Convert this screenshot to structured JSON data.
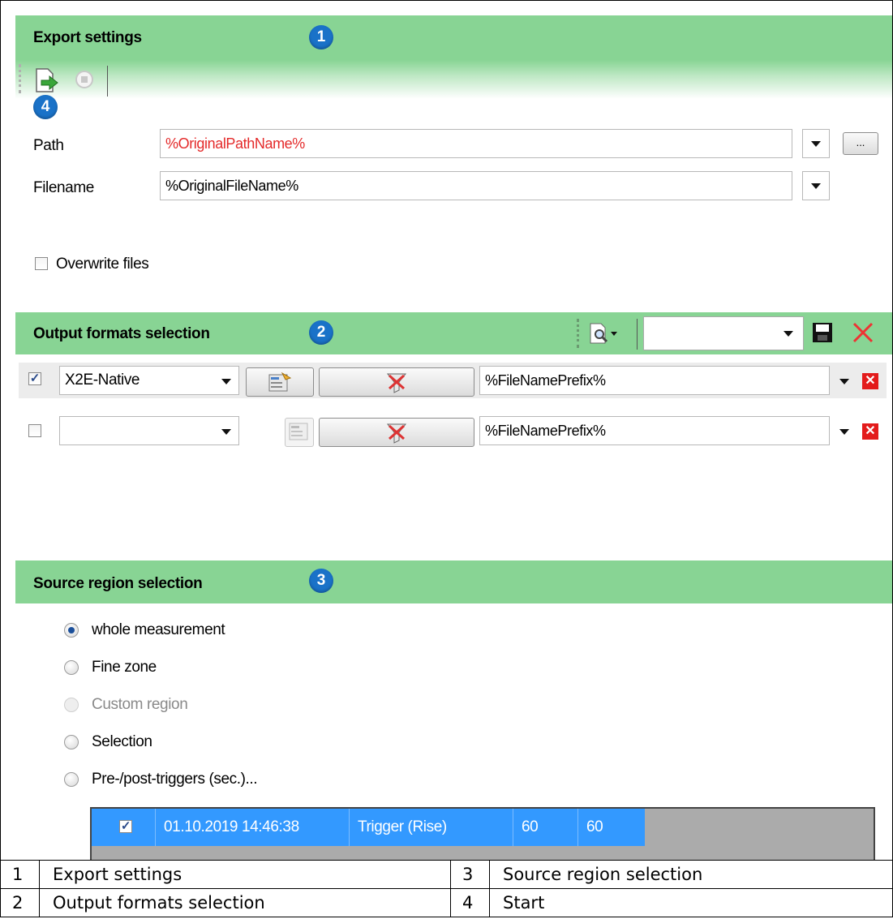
{
  "export_settings": {
    "title": "Export settings",
    "badge": "1",
    "start_badge": "4",
    "path_label": "Path",
    "path_value": "%OriginalPathName%",
    "browse_label": "...",
    "filename_label": "Filename",
    "filename_value": "%OriginalFileName%",
    "overwrite_label": "Overwrite files"
  },
  "output_formats": {
    "title": "Output formats selection",
    "badge": "2",
    "rows": [
      {
        "format": "X2E-Native",
        "prefix": "%FileNamePrefix%",
        "checked": true
      },
      {
        "format": "",
        "prefix": "%FileNamePrefix%",
        "checked": false
      }
    ]
  },
  "source_region": {
    "title": "Source region selection",
    "badge": "3",
    "options": [
      "whole measurement",
      "Fine zone",
      "Custom region",
      "Selection",
      "Pre-/post-triggers (sec.)..."
    ],
    "trigger_row": {
      "date": "01.10.2019 14:46:38",
      "type": "Trigger (Rise)",
      "pre": "60",
      "post": "60"
    }
  },
  "legend": [
    {
      "num": "1",
      "label": "Export settings"
    },
    {
      "num": "3",
      "label": "Source region selection"
    },
    {
      "num": "2",
      "label": "Output formats selection"
    },
    {
      "num": "4",
      "label": "Start"
    }
  ],
  "colors": {
    "header_green": "#88d494",
    "badge_blue": "#1a72c8",
    "selection_blue": "#3399ff",
    "error_red": "#e42a2a"
  }
}
